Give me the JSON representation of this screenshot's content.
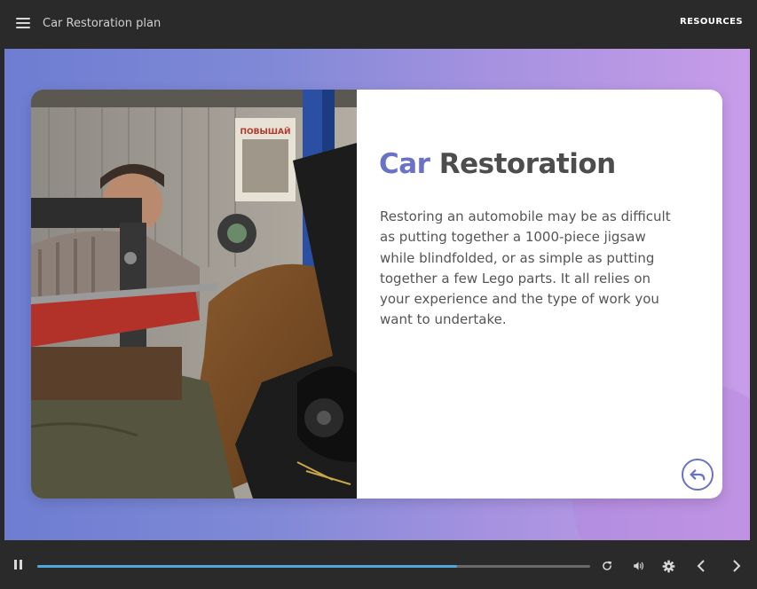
{
  "header": {
    "title": "Car Restoration plan",
    "resources_label": "RESOURCES"
  },
  "slide": {
    "heading_part1": "Car",
    "heading_part2": "Restoration",
    "body": "Restoring an automobile may be as difficult as putting together a 1000-piece jigsaw while blindfolded, or as simple as putting together a few Lego parts. It all relies on your experience and the type of work you want to undertake.",
    "poster_text": "ПОВЫШАЙ"
  },
  "player": {
    "progress": 0.76
  },
  "colors": {
    "accent": "#6a72c5",
    "progress_fill": "#4fa6e0",
    "bar_bg": "#2a2a2a"
  },
  "icons": [
    "menu-icon",
    "photo",
    "back-arrow-icon",
    "pause-icon",
    "replay-icon",
    "volume-icon",
    "gear-icon",
    "chevron-left-icon",
    "chevron-right-icon"
  ]
}
